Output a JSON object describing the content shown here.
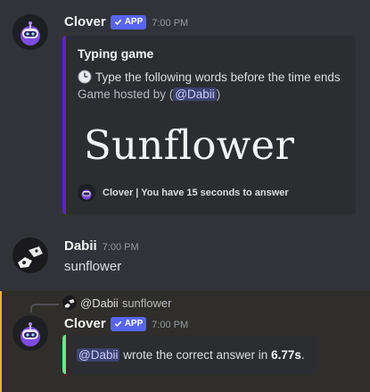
{
  "messages": {
    "clover_first": {
      "username": "Clover",
      "badge": "APP",
      "timestamp": "7:00 PM",
      "embed": {
        "title": "Typing game",
        "description": "Type the following words before the time ends",
        "host_prefix": "Game hosted by (",
        "host_mention": "@Dabii",
        "host_suffix": ")",
        "word": "Sunflower",
        "footer": "Clover | You have 15 seconds to answer",
        "accent_color": "#5b1fd9"
      }
    },
    "dabii": {
      "username": "Dabii",
      "timestamp": "7:00 PM",
      "text": "sunflower"
    },
    "clover_reply": {
      "reply_ref": {
        "mention": "@Dabii",
        "text": "sunflower"
      },
      "username": "Clover",
      "badge": "APP",
      "timestamp": "7:00 PM",
      "embed": {
        "mention": "@Dabii",
        "text_before": "wrote the correct answer in",
        "time": "6.77s",
        "text_after": ".",
        "accent_color": "#57f287"
      }
    }
  },
  "colors": {
    "background": "#313338",
    "embed_bg": "#2b2d31",
    "badge": "#5865f2",
    "mention_bg": "#3c4270",
    "highlight_border": "#f0b232"
  },
  "icons": {
    "clover_avatar": "robot-avatar-icon",
    "dabii_avatar": "cat-avatar-icon",
    "clock": "clock-icon",
    "verified": "checkmark-icon"
  }
}
